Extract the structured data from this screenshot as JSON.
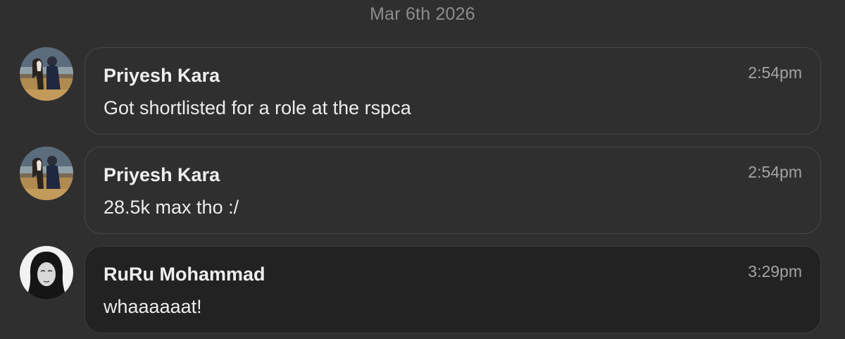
{
  "conversation": {
    "date": "Mar 6th 2026",
    "messages": [
      {
        "sender": "Priyesh Kara",
        "time": "2:54pm",
        "text": "Got shortlisted for a role at the rspca",
        "avatar": "photo-person-with-horse"
      },
      {
        "sender": "Priyesh Kara",
        "time": "2:54pm",
        "text": "28.5k max tho :/",
        "avatar": "photo-person-with-horse"
      },
      {
        "sender": "RuRu Mohammad",
        "time": "3:29pm",
        "text": "whaaaaaat!",
        "avatar": "photo-person-in-hijab"
      }
    ]
  }
}
